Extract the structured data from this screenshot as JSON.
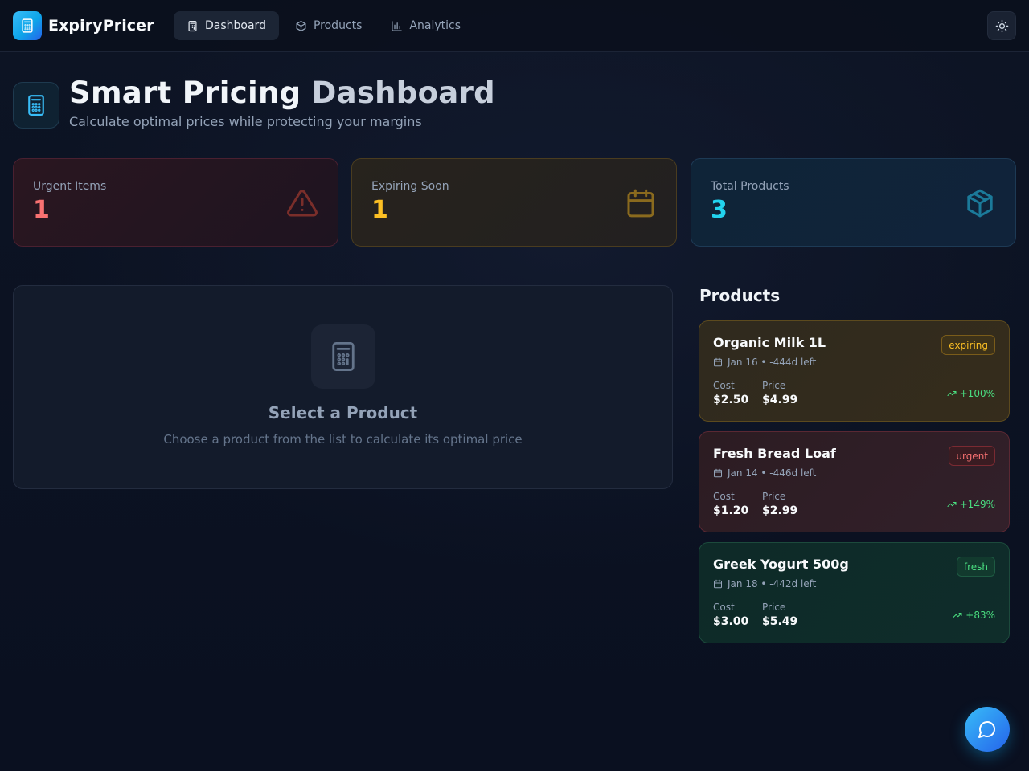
{
  "app": {
    "name": "ExpiryPricer",
    "accent": "#0ea5e9"
  },
  "nav": {
    "items": [
      {
        "label": "Dashboard",
        "icon": "calculator-icon",
        "active": true
      },
      {
        "label": "Products",
        "icon": "box-icon",
        "active": false
      },
      {
        "label": "Analytics",
        "icon": "bar-chart-icon",
        "active": false
      }
    ],
    "theme_toggle_icon": "sun-icon"
  },
  "header": {
    "title_part1": "Smart Pricing",
    "title_part2": "Dashboard",
    "subtitle": "Calculate optimal prices while protecting your margins"
  },
  "stats": {
    "urgent": {
      "label": "Urgent Items",
      "value": "1",
      "icon": "alert-triangle-icon",
      "color": "#f87171"
    },
    "expiring": {
      "label": "Expiring Soon",
      "value": "1",
      "icon": "calendar-icon",
      "color": "#fbbf24"
    },
    "total": {
      "label": "Total Products",
      "value": "3",
      "icon": "box-icon",
      "color": "#22d3ee"
    }
  },
  "empty_state": {
    "icon": "calculator-icon",
    "title": "Select a Product",
    "subtitle": "Choose a product from the list to calculate its optimal price"
  },
  "products": {
    "title": "Products",
    "items": [
      {
        "name": "Organic Milk 1L",
        "status": "expiring",
        "date": "Jan 16",
        "days_left": "-444d left",
        "date_line": "Jan 16 • -444d left",
        "cost_label": "Cost",
        "cost": "$2.50",
        "price_label": "Price",
        "price": "$4.99",
        "margin": "+100%"
      },
      {
        "name": "Fresh Bread Loaf",
        "status": "urgent",
        "date": "Jan 14",
        "days_left": "-446d left",
        "date_line": "Jan 14 • -446d left",
        "cost_label": "Cost",
        "cost": "$1.20",
        "price_label": "Price",
        "price": "$2.99",
        "margin": "+149%"
      },
      {
        "name": "Greek Yogurt 500g",
        "status": "fresh",
        "date": "Jan 18",
        "days_left": "-442d left",
        "date_line": "Jan 18 • -442d left",
        "cost_label": "Cost",
        "cost": "$3.00",
        "price_label": "Price",
        "price": "$5.49",
        "margin": "+83%"
      }
    ]
  },
  "chat_button": {
    "icon": "message-circle-icon"
  }
}
